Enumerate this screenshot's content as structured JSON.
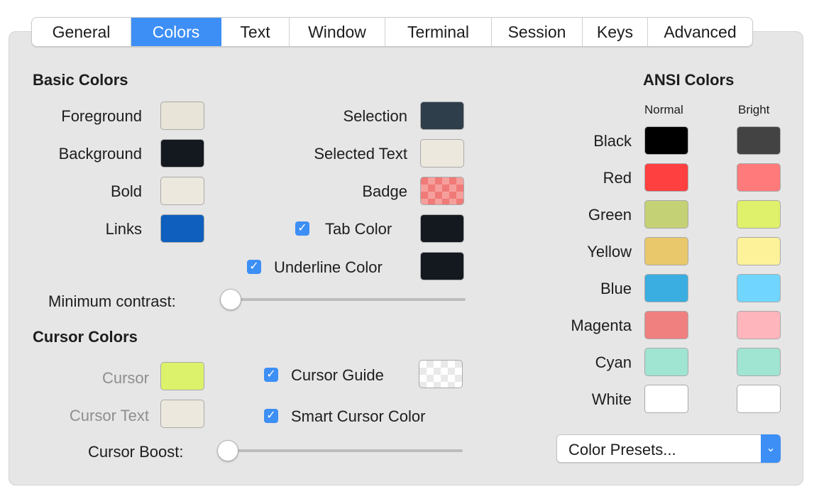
{
  "tabs": [
    {
      "label": "General",
      "active": false
    },
    {
      "label": "Colors",
      "active": true
    },
    {
      "label": "Text",
      "active": false
    },
    {
      "label": "Window",
      "active": false
    },
    {
      "label": "Terminal",
      "active": false
    },
    {
      "label": "Session",
      "active": false
    },
    {
      "label": "Keys",
      "active": false
    },
    {
      "label": "Advanced",
      "active": false
    }
  ],
  "basic": {
    "title": "Basic Colors",
    "foreground": {
      "label": "Foreground",
      "color": "#e8e4d8"
    },
    "background": {
      "label": "Background",
      "color": "#14191f"
    },
    "bold": {
      "label": "Bold",
      "color": "#ede8de"
    },
    "links": {
      "label": "Links",
      "color": "#0e5fbe"
    },
    "selection": {
      "label": "Selection",
      "color": "#2f3e4b"
    },
    "selected_text": {
      "label": "Selected Text",
      "color": "#ede8de"
    },
    "badge": {
      "label": "Badge",
      "color": "#f07a78"
    },
    "tab_color": {
      "label": "Tab Color",
      "color": "#14191f",
      "checked": true
    },
    "underline_color": {
      "label": "Underline Color",
      "color": "#14191f",
      "checked": true
    },
    "min_contrast": {
      "label": "Minimum contrast:",
      "value": 0
    }
  },
  "cursor": {
    "title": "Cursor Colors",
    "cursor": {
      "label": "Cursor",
      "color": "#dcf26a"
    },
    "cursor_text": {
      "label": "Cursor Text",
      "color": "#ede8de"
    },
    "cursor_guide": {
      "label": "Cursor Guide",
      "checked": true
    },
    "smart_cursor": {
      "label": "Smart Cursor Color",
      "checked": true
    },
    "cursor_boost": {
      "label": "Cursor Boost:",
      "value": 0
    }
  },
  "ansi": {
    "title": "ANSI Colors",
    "normal_label": "Normal",
    "bright_label": "Bright",
    "rows": [
      {
        "name": "Black",
        "normal": "#000000",
        "bright": "#434343"
      },
      {
        "name": "Red",
        "normal": "#ff4040",
        "bright": "#ff7a7a"
      },
      {
        "name": "Green",
        "normal": "#c5d175",
        "bright": "#dff06a"
      },
      {
        "name": "Yellow",
        "normal": "#e8c86a",
        "bright": "#fdf29a"
      },
      {
        "name": "Blue",
        "normal": "#3aaee0",
        "bright": "#70d6ff"
      },
      {
        "name": "Magenta",
        "normal": "#f08080",
        "bright": "#ffb5bc"
      },
      {
        "name": "Cyan",
        "normal": "#a0e4d2",
        "bright": "#a0e4d2"
      },
      {
        "name": "White",
        "normal": "#ffffff",
        "bright": "#ffffff"
      }
    ]
  },
  "presets": {
    "label": "Color Presets...",
    "icon": "chevron-down-icon"
  }
}
